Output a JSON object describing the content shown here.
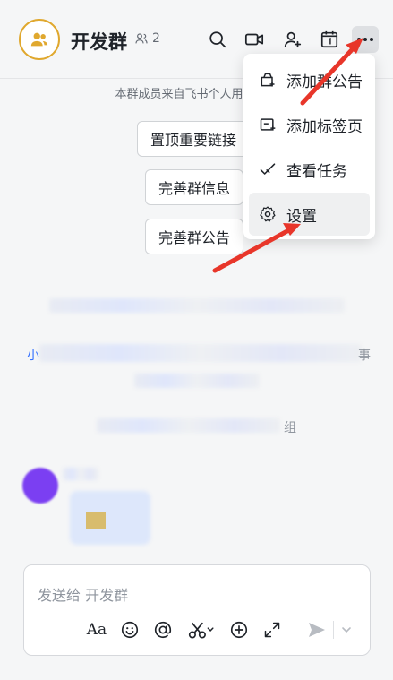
{
  "header": {
    "group_name": "开发群",
    "member_count": "2"
  },
  "notice": "本群成员来自飞书个人用户、用",
  "pills": {
    "pin_link": "置顶重要链接",
    "complete_info": "完善群信息",
    "complete_notice": "完善群公告"
  },
  "system": {
    "prefix": "小",
    "suffix": "事",
    "group_suffix": "组"
  },
  "menu": {
    "items": [
      {
        "label": "添加群公告",
        "icon": "notice-plus-icon"
      },
      {
        "label": "添加标签页",
        "icon": "tab-plus-icon"
      },
      {
        "label": "查看任务",
        "icon": "task-check-icon"
      },
      {
        "label": "设置",
        "icon": "gear-icon"
      }
    ]
  },
  "composer": {
    "placeholder": "发送给 开发群"
  },
  "colors": {
    "accent": "#e0a82e",
    "arrow": "#e8362a",
    "purple": "#7b3ff2"
  }
}
